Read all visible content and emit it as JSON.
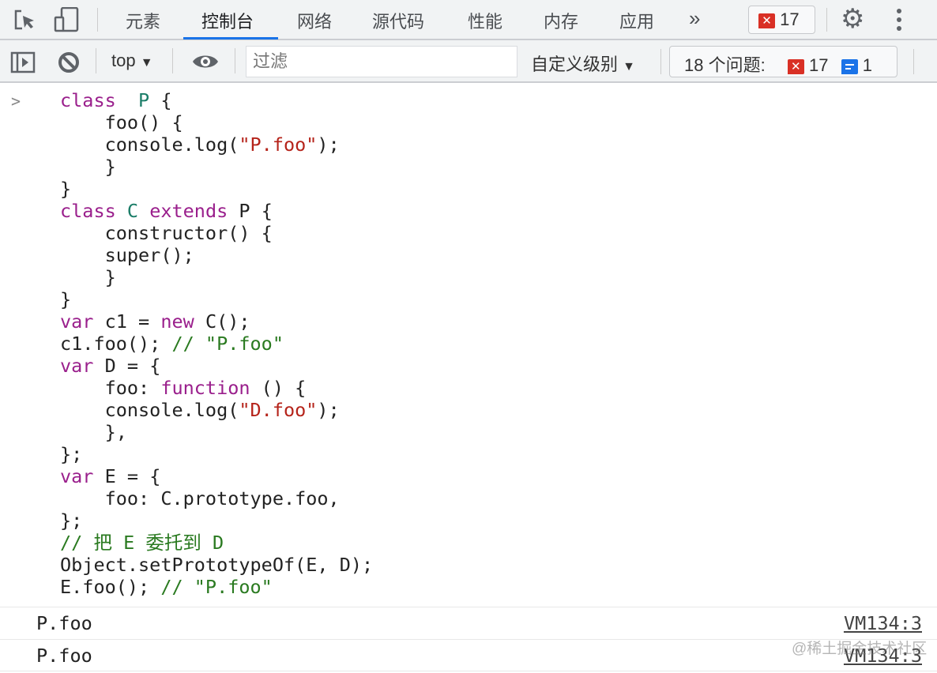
{
  "tabs": [
    {
      "label": "元素"
    },
    {
      "label": "控制台",
      "active": true
    },
    {
      "label": "网络"
    },
    {
      "label": "源代码"
    },
    {
      "label": "性能"
    },
    {
      "label": "内存"
    },
    {
      "label": "应用"
    }
  ],
  "more_tabs_label": "»",
  "error_badge": {
    "count": "17"
  },
  "toolbar": {
    "context": "top",
    "filter_placeholder": "过滤",
    "levels": "自定义级别",
    "issues_label": "18 个问题:",
    "issues_errors": "17",
    "issues_info": "1"
  },
  "prompt": ">",
  "code_lines": [
    [
      [
        "kw",
        "class"
      ],
      [
        "",
        "  "
      ],
      [
        "cls",
        "P"
      ],
      [
        "",
        " {"
      ]
    ],
    [
      [
        "",
        "    foo() {"
      ]
    ],
    [
      [
        "",
        "    console.log("
      ],
      [
        "str",
        "\"P.foo\""
      ],
      [
        "",
        ");"
      ]
    ],
    [
      [
        "",
        "    }"
      ]
    ],
    [
      [
        "",
        "}"
      ]
    ],
    [
      [
        "kw",
        "class"
      ],
      [
        "",
        " "
      ],
      [
        "cls",
        "C"
      ],
      [
        "",
        " "
      ],
      [
        "kw",
        "extends"
      ],
      [
        "",
        " P {"
      ]
    ],
    [
      [
        "",
        "    constructor() {"
      ]
    ],
    [
      [
        "",
        "    super();"
      ]
    ],
    [
      [
        "",
        "    }"
      ]
    ],
    [
      [
        "",
        "}"
      ]
    ],
    [
      [
        "kw",
        "var"
      ],
      [
        "",
        " c1 = "
      ],
      [
        "kw",
        "new"
      ],
      [
        "",
        " C();"
      ]
    ],
    [
      [
        "",
        "c1.foo(); "
      ],
      [
        "cmt",
        "// \"P.foo\""
      ]
    ],
    [
      [
        "kw",
        "var"
      ],
      [
        "",
        " D = {"
      ]
    ],
    [
      [
        "",
        "    foo: "
      ],
      [
        "kw",
        "function"
      ],
      [
        "",
        " () {"
      ]
    ],
    [
      [
        "",
        "    console.log("
      ],
      [
        "str",
        "\"D.foo\""
      ],
      [
        "",
        ");"
      ]
    ],
    [
      [
        "",
        "    },"
      ]
    ],
    [
      [
        "",
        "};"
      ]
    ],
    [
      [
        "kw",
        "var"
      ],
      [
        "",
        " E = {"
      ]
    ],
    [
      [
        "",
        "    foo: C.prototype.foo,"
      ]
    ],
    [
      [
        "",
        "};"
      ]
    ],
    [
      [
        "cmt",
        "// 把 E 委托到 D"
      ]
    ],
    [
      [
        "",
        "Object.setPrototypeOf(E, D);"
      ]
    ],
    [
      [
        "",
        "E.foo(); "
      ],
      [
        "cmt",
        "// \"P.foo\""
      ]
    ]
  ],
  "output": [
    {
      "message": "P.foo",
      "source": "VM134:3"
    },
    {
      "message": "P.foo",
      "source": "VM134:3"
    }
  ],
  "watermark": "@稀土掘金技术社区",
  "colors": {
    "accent": "#1a73e8",
    "error": "#d93025",
    "keyword": "#9a1f8c",
    "class_name": "#1b7d68",
    "string": "#b5231a",
    "comment": "#2a7a20"
  }
}
